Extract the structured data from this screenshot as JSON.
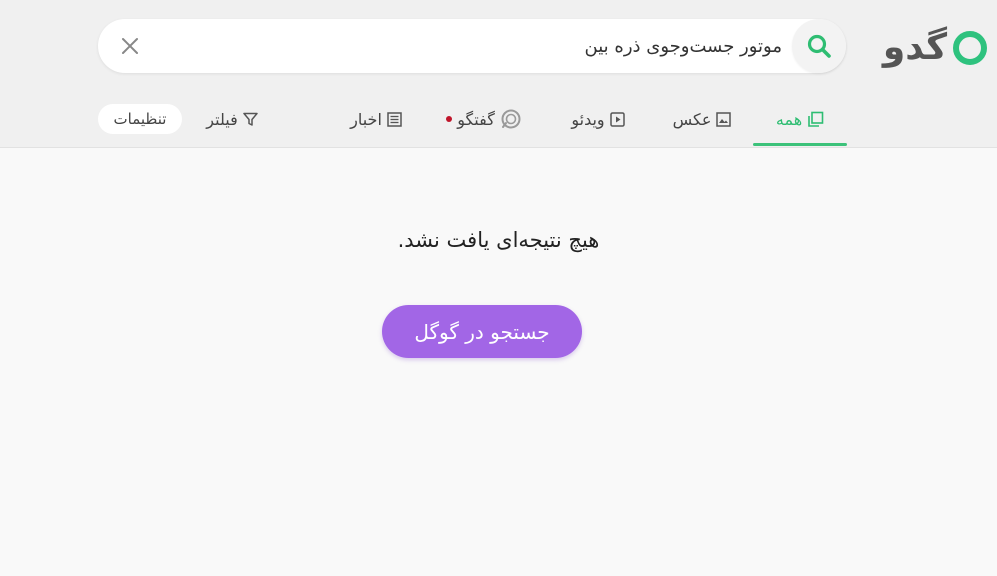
{
  "logo": {
    "text": "گدو"
  },
  "search": {
    "value": "موتور جست‌وجوی ذره بین",
    "button_icon": "search-icon",
    "clear_icon": "close-icon"
  },
  "tabs": [
    {
      "label": "همه",
      "icon": "pages-icon",
      "active": true
    },
    {
      "label": "عکس",
      "icon": "image-icon"
    },
    {
      "label": "ویدئو",
      "icon": "video-icon"
    },
    {
      "label": "گفتگو",
      "icon": "chat-icon",
      "badge": "new-dot"
    },
    {
      "label": "اخبار",
      "icon": "news-icon"
    }
  ],
  "filter": {
    "label": "فیلتر",
    "icon": "filter-icon"
  },
  "settings": {
    "label": "تنظیمات"
  },
  "results": {
    "empty_message": "هیچ نتیجه‌ای یافت نشد.",
    "google_button": "جستجو در گوگل"
  },
  "colors": {
    "brand_green": "#2ebd72",
    "google_button": "#a266e6",
    "badge_red": "#c0152a"
  }
}
